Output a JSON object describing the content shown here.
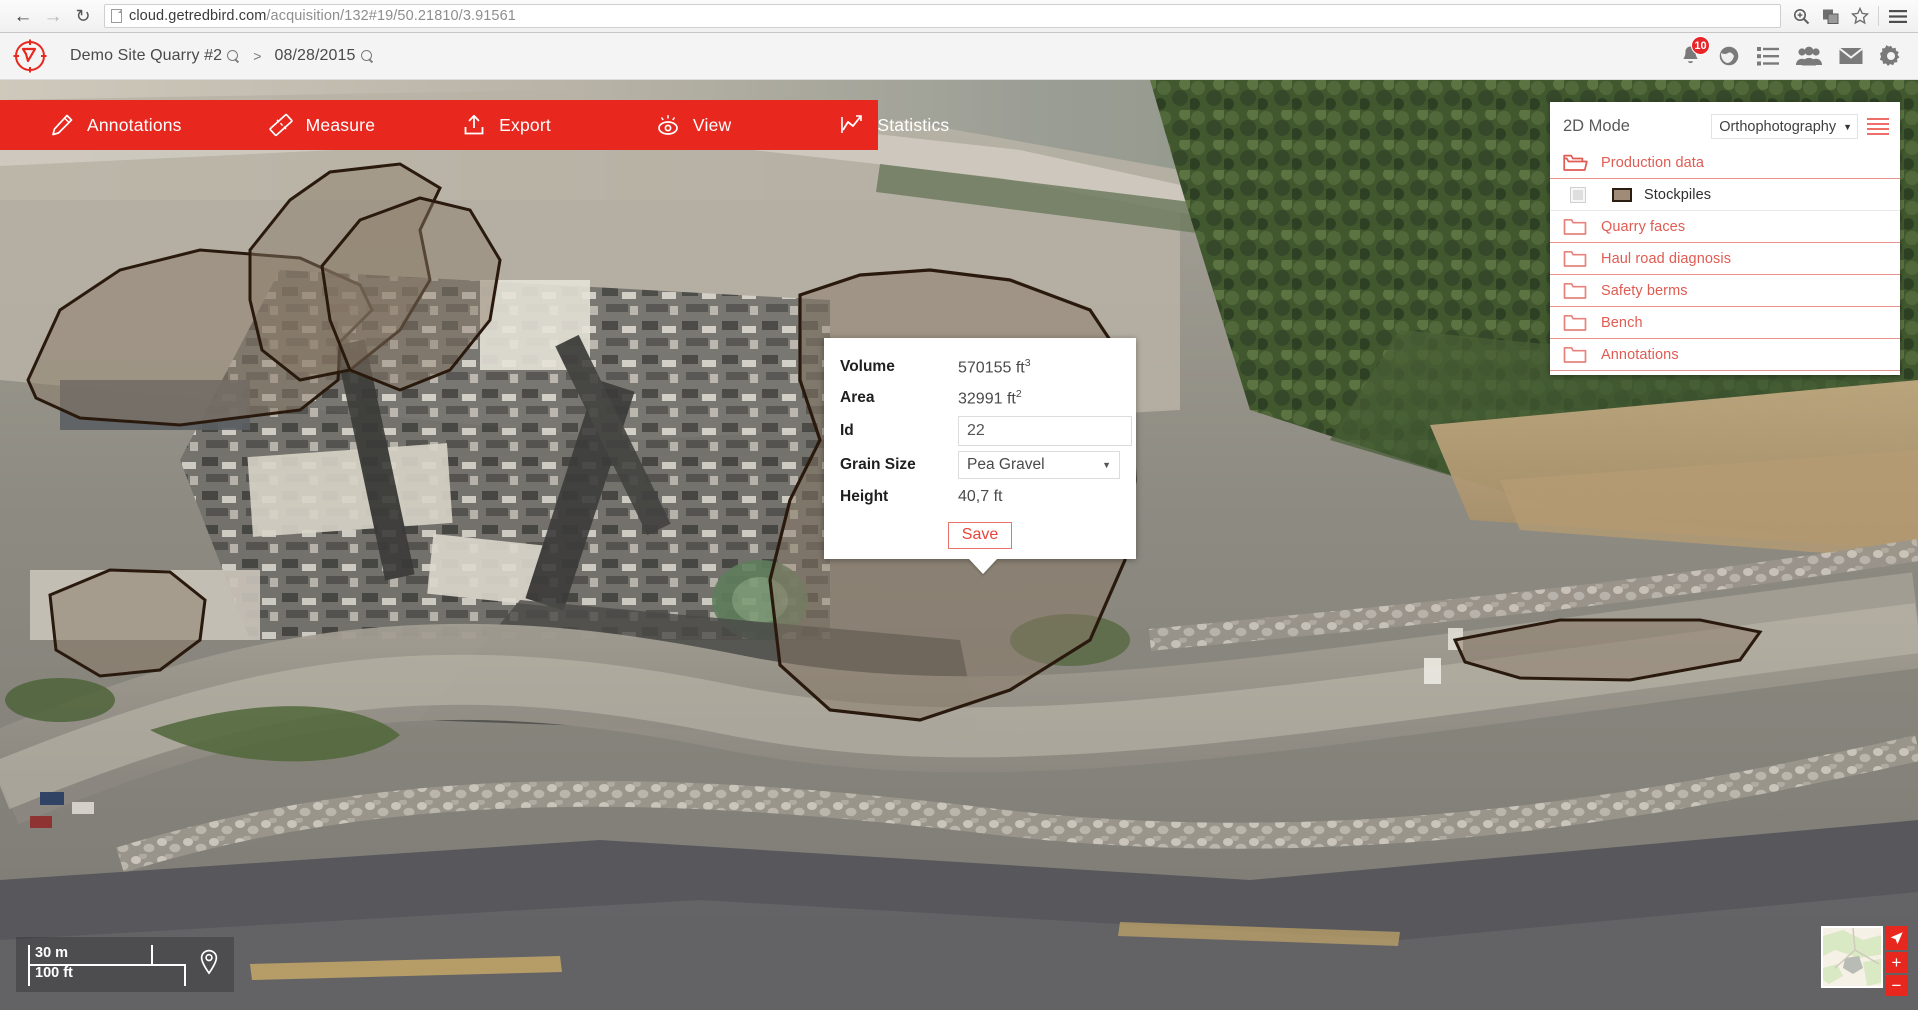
{
  "browser": {
    "back_icon": "back-arrow-icon",
    "forward_icon": "forward-arrow-icon",
    "reload_icon": "reload-icon",
    "url_host": "cloud.getredbird.com",
    "url_path": "/acquisition/132#19/50.21810/3.91561",
    "url_full": "cloud.getredbird.com/acquisition/132#19/50.21810/3.91561",
    "icons": [
      "zoom-icon",
      "translate-icon",
      "bookmark-star-icon",
      "menu-icon"
    ]
  },
  "header": {
    "logo_name": "redbird-logo",
    "breadcrumb": {
      "site": "Demo Site Quarry #2",
      "separator": ">",
      "date": "08/28/2015"
    },
    "right_icons": [
      {
        "name": "notifications-bell-icon",
        "badge": "10"
      },
      {
        "name": "globe-icon",
        "badge": null
      },
      {
        "name": "list-icon",
        "badge": null
      },
      {
        "name": "users-icon",
        "badge": null
      },
      {
        "name": "mail-icon",
        "badge": null
      },
      {
        "name": "settings-gear-icon",
        "badge": null
      }
    ]
  },
  "toolbar": {
    "background": "#e8281f",
    "items": [
      {
        "label": "Annotations",
        "icon": "pencil-icon"
      },
      {
        "label": "Measure",
        "icon": "ruler-icon"
      },
      {
        "label": "Export",
        "icon": "upload-icon"
      },
      {
        "label": "View",
        "icon": "eye-icon"
      },
      {
        "label": "Statistics",
        "icon": "chart-line-icon"
      }
    ]
  },
  "popup": {
    "fields": [
      {
        "label": "Volume",
        "value": "570155 ft",
        "exp": "3",
        "type": "text"
      },
      {
        "label": "Area",
        "value": "32991 ft",
        "exp": "2",
        "type": "text"
      },
      {
        "label": "Id",
        "value": "22",
        "type": "input"
      },
      {
        "label": "Grain Size",
        "value": "Pea Gravel",
        "type": "select"
      },
      {
        "label": "Height",
        "value": "40,7 ft",
        "exp": "",
        "type": "text"
      }
    ],
    "save_label": "Save",
    "save_color": "#e8453c"
  },
  "layers": {
    "mode_label": "2D Mode",
    "basemap_selected": "Orthophotography",
    "menu_icon": "layers-menu-icon",
    "accent": "#e05b52",
    "groups": [
      {
        "name": "Production data",
        "icon": "folder-open-icon",
        "open": true,
        "children": [
          {
            "name": "Stockpiles",
            "checked": false,
            "swatch": "#a08b78",
            "swatch_border": "#2b1d12"
          }
        ]
      },
      {
        "name": "Quarry faces",
        "icon": "folder-icon",
        "open": false,
        "children": []
      },
      {
        "name": "Haul road diagnosis",
        "icon": "folder-icon",
        "open": false,
        "children": []
      },
      {
        "name": "Safety berms",
        "icon": "folder-icon",
        "open": false,
        "children": []
      },
      {
        "name": "Bench",
        "icon": "folder-icon",
        "open": false,
        "children": []
      },
      {
        "name": "Annotations",
        "icon": "folder-icon",
        "open": false,
        "children": []
      }
    ]
  },
  "scalebar": {
    "metric": "30 m",
    "imperial": "100 ft",
    "pin_icon": "location-pin-icon"
  },
  "minimap": {
    "nav_icon": "navigate-arrow-icon",
    "zoom_in": "+",
    "zoom_out": "−"
  }
}
